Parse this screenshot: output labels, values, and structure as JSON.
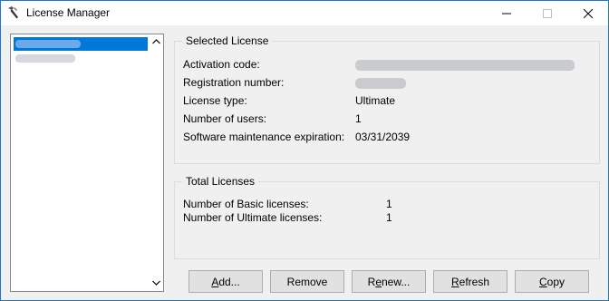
{
  "window": {
    "title": "License Manager",
    "icons": {
      "app": "wrench-hammer-icon",
      "minimize": "minimize-icon",
      "maximize": "maximize-icon",
      "close": "close-icon"
    }
  },
  "license_list": {
    "items": [
      {
        "label": "",
        "selected": true,
        "redacted": true
      },
      {
        "label": "",
        "selected": false,
        "redacted": true
      }
    ],
    "selection_color": "#0078d7"
  },
  "selected_license": {
    "title": "Selected License",
    "rows": [
      {
        "label": "Activation code:",
        "value": "",
        "redacted": true
      },
      {
        "label": "Registration number:",
        "value": "",
        "redacted": true
      },
      {
        "label": "License type:",
        "value": "Ultimate"
      },
      {
        "label": "Number of users:",
        "value": "1"
      },
      {
        "label": "Software maintenance expiration:",
        "value": "03/31/2039"
      }
    ]
  },
  "total_licenses": {
    "title": "Total Licenses",
    "rows": [
      {
        "label": "Number of Basic licenses:",
        "value": "1"
      },
      {
        "label": "Number of Ultimate licenses:",
        "value": "1"
      }
    ]
  },
  "buttons": {
    "add": {
      "mnemonic": "A",
      "rest": "dd..."
    },
    "remove": {
      "label": "Remove"
    },
    "renew": {
      "pre": "R",
      "mnemonic": "e",
      "rest": "new..."
    },
    "refresh": {
      "mnemonic": "R",
      "rest": "efresh"
    },
    "copy": {
      "mnemonic": "C",
      "rest": "opy"
    }
  }
}
